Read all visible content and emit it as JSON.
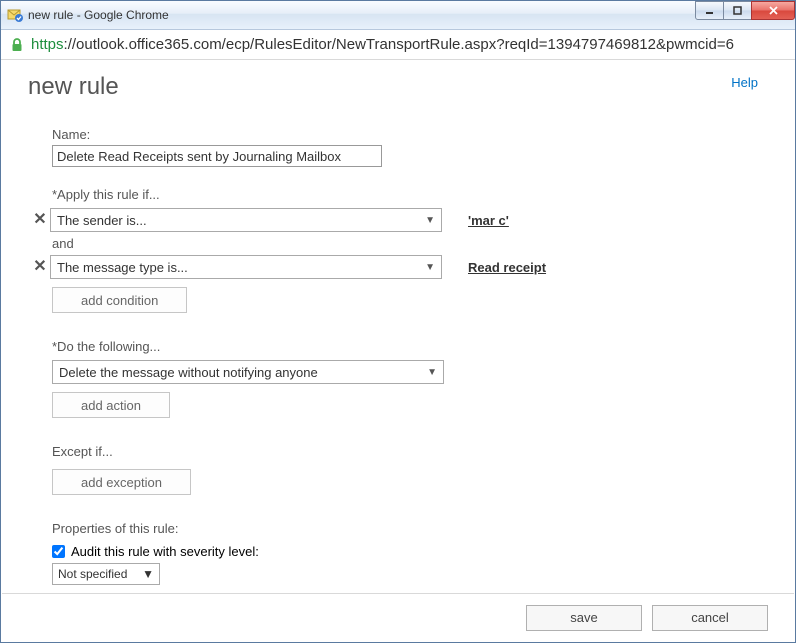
{
  "window": {
    "title": "new rule - Google Chrome"
  },
  "address": {
    "scheme": "https",
    "rest": "://outlook.office365.com/ecp/RulesEditor/NewTransportRule.aspx?reqId=1394797469812&pwmcid=6"
  },
  "help_label": "Help",
  "page_title": "new rule",
  "name": {
    "label": "Name:",
    "value": "Delete Read Receipts sent by Journaling Mailbox"
  },
  "apply_if": {
    "heading": "*Apply this rule if...",
    "conditions": [
      {
        "dropdown": "The sender is...",
        "value": "'mar c'"
      },
      {
        "dropdown": "The message type is...",
        "value": "Read receipt"
      }
    ],
    "and_label": "and",
    "add_btn": "add condition"
  },
  "do_following": {
    "heading": "*Do the following...",
    "action": "Delete the message without notifying anyone",
    "add_btn": "add action"
  },
  "except_if": {
    "heading": "Except if...",
    "add_btn": "add exception"
  },
  "properties": {
    "heading": "Properties of this rule:",
    "audit_label": "Audit this rule with severity level:",
    "audit_checked": true,
    "severity": "Not specified"
  },
  "footer": {
    "save": "save",
    "cancel": "cancel"
  }
}
